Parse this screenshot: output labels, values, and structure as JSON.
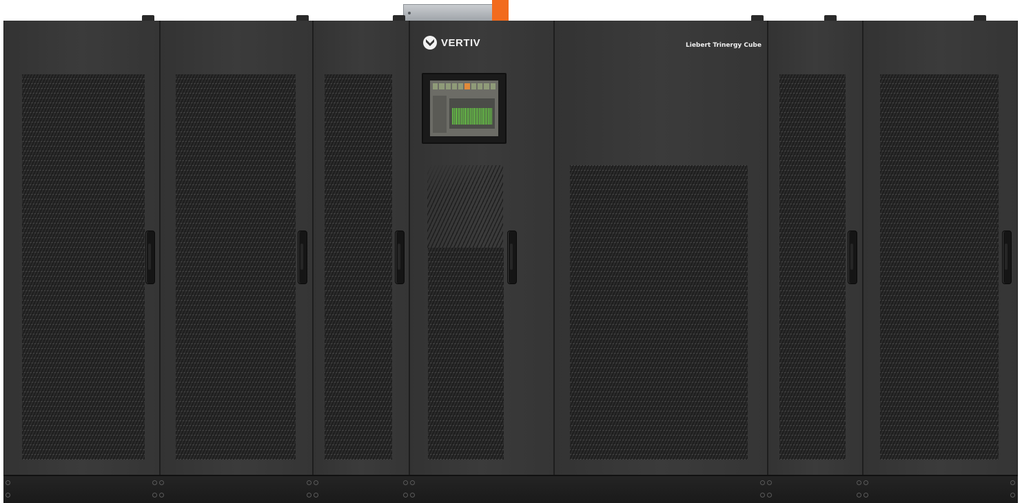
{
  "brand": {
    "logo_icon": "vertiv-chevron-icon",
    "name": "VERTIV",
    "model": "Liebert Trinergy Cube"
  },
  "colors": {
    "cabinet": "#353535",
    "accent": "#f26b1d",
    "display_bars": "#66c444"
  },
  "icons": [
    "vertiv-chevron-icon",
    "door-handle",
    "vent-grille",
    "touchscreen-display"
  ]
}
